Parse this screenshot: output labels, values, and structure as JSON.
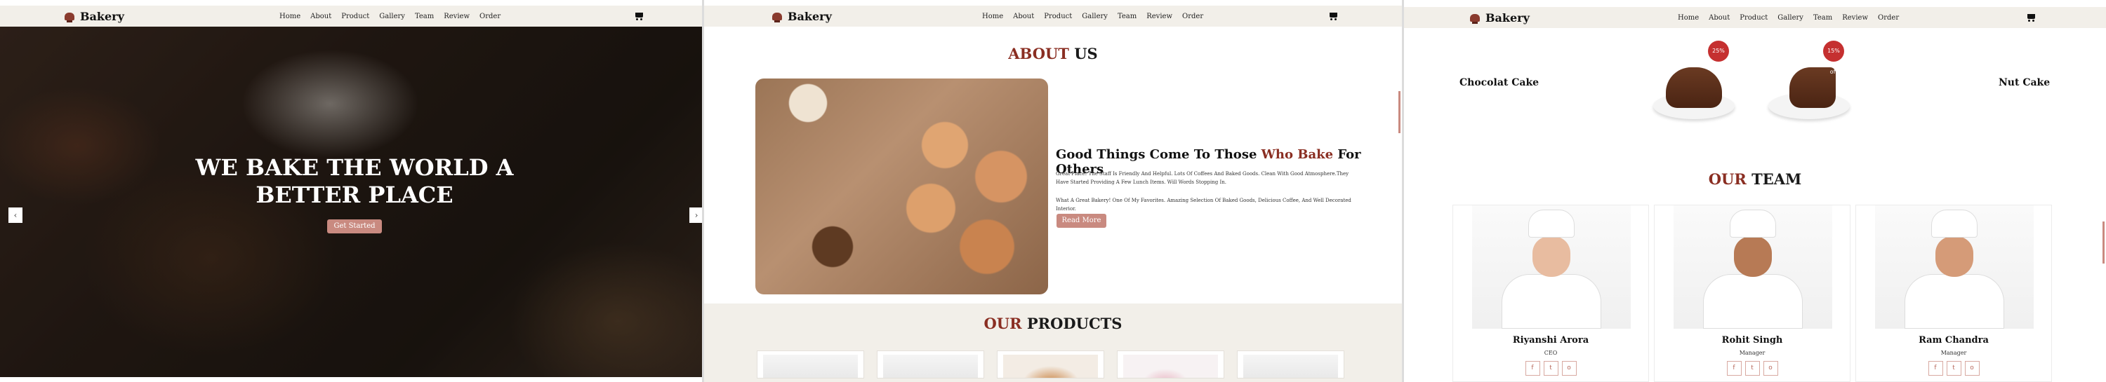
{
  "nav": {
    "brand": "Bakery",
    "brand_icon": "bakery-logo-icon",
    "cart_icon": "cart-icon",
    "items": [
      "Home",
      "About",
      "Product",
      "Gallery",
      "Team",
      "Review",
      "Order"
    ]
  },
  "hero": {
    "line1": "WE BAKE THE WORLD A",
    "line2": "BETTER PLACE",
    "cta": "Get Started",
    "prev_icon": "‹",
    "next_icon": "›"
  },
  "about": {
    "title_accent": "ABOUT",
    "title_dark": " US",
    "heading_pre": "Good Things Come To Those ",
    "heading_accent": "Who Bake",
    "heading_post": " For Others",
    "para1": "Great Place! The Staff Is Friendly And Helpful. Lots Of Coffees And Baked Goods. Clean With Good Atmosphere.They Have Started Providing A Few Lunch Items. Will Words Stopping In.",
    "para2": "What A Great Bakery! One Of My Favorites. Amazing Selection Of Baked Goods, Delicious Coffee, And Well Decorated Interior.",
    "button": "Read More"
  },
  "products": {
    "title_accent": "OUR",
    "title_dark": " PRODUCTS"
  },
  "cakes": {
    "left_name": "Chocolat Cake",
    "right_name": "Nut Cake",
    "badge1": "25% off",
    "badge2": "15% off"
  },
  "team": {
    "title_accent": "OUR",
    "title_dark": " TEAM",
    "members": [
      {
        "name": "Riyanshi Arora",
        "role": "CEO"
      },
      {
        "name": "Rohit Singh",
        "role": "Manager"
      },
      {
        "name": "Ram Chandra",
        "role": "Manager"
      }
    ],
    "social_icons": [
      "f",
      "t",
      "o"
    ]
  },
  "colors": {
    "accent": "#8a2e22",
    "button": "#c98a80",
    "nav_bg": "#f2efe9"
  }
}
